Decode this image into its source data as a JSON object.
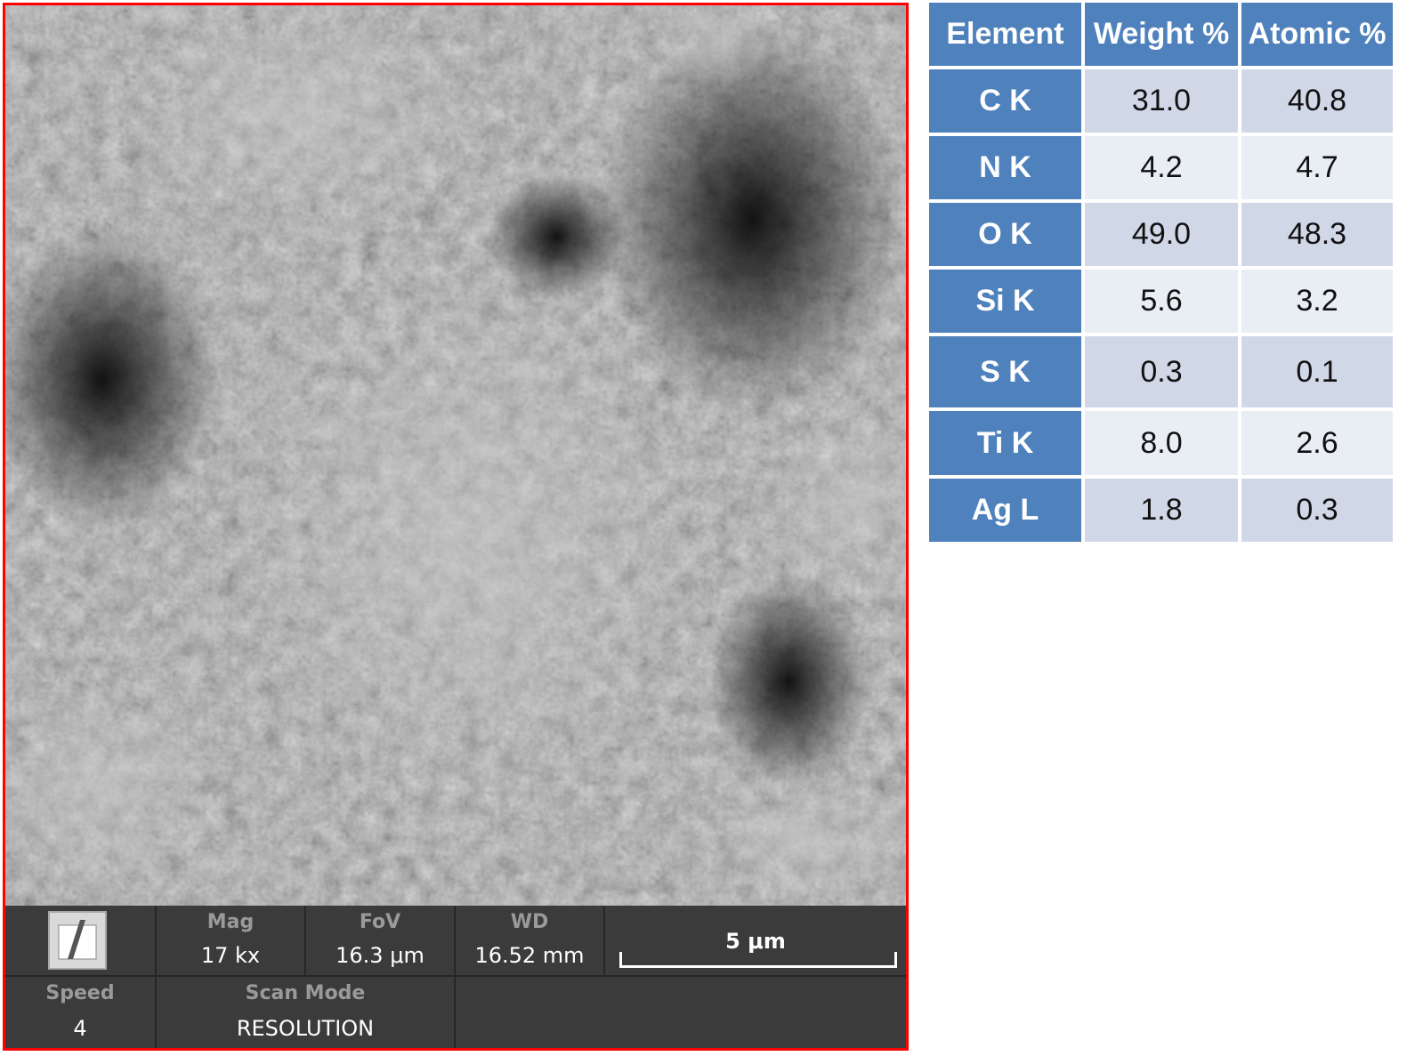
{
  "sem": {
    "databar": {
      "mag_label": "Mag",
      "mag_value": "17 kx",
      "fov_label": "FoV",
      "fov_value": "16.3 μm",
      "wd_label": "WD",
      "wd_value": "16.52 mm",
      "scale_bar_label": "5 μm",
      "speed_label": "Speed",
      "speed_value": "4",
      "scan_mode_label": "Scan Mode",
      "scan_mode_value": "RESOLUTION"
    },
    "logo_icon": "phenom-logo-icon",
    "frame_color": "#ff0000"
  },
  "eds_table": {
    "headers": [
      "Element",
      "Weight %",
      "Atomic %"
    ],
    "rows": [
      {
        "element": "C  K",
        "weight": "31.0",
        "atomic": "40.8"
      },
      {
        "element": "N  K",
        "weight": "4.2",
        "atomic": "4.7"
      },
      {
        "element": "O K",
        "weight": "49.0",
        "atomic": "48.3"
      },
      {
        "element": "Si K",
        "weight": "5.6",
        "atomic": "3.2"
      },
      {
        "element": "S  K",
        "weight": "0.3",
        "atomic": "0.1"
      },
      {
        "element": "Ti K",
        "weight": "8.0",
        "atomic": "2.6"
      },
      {
        "element": "Ag L",
        "weight": "1.8",
        "atomic": "0.3"
      }
    ],
    "header_color": "#4f81bd",
    "row_colors": [
      "#d0d8e8",
      "#e9edf4"
    ]
  }
}
